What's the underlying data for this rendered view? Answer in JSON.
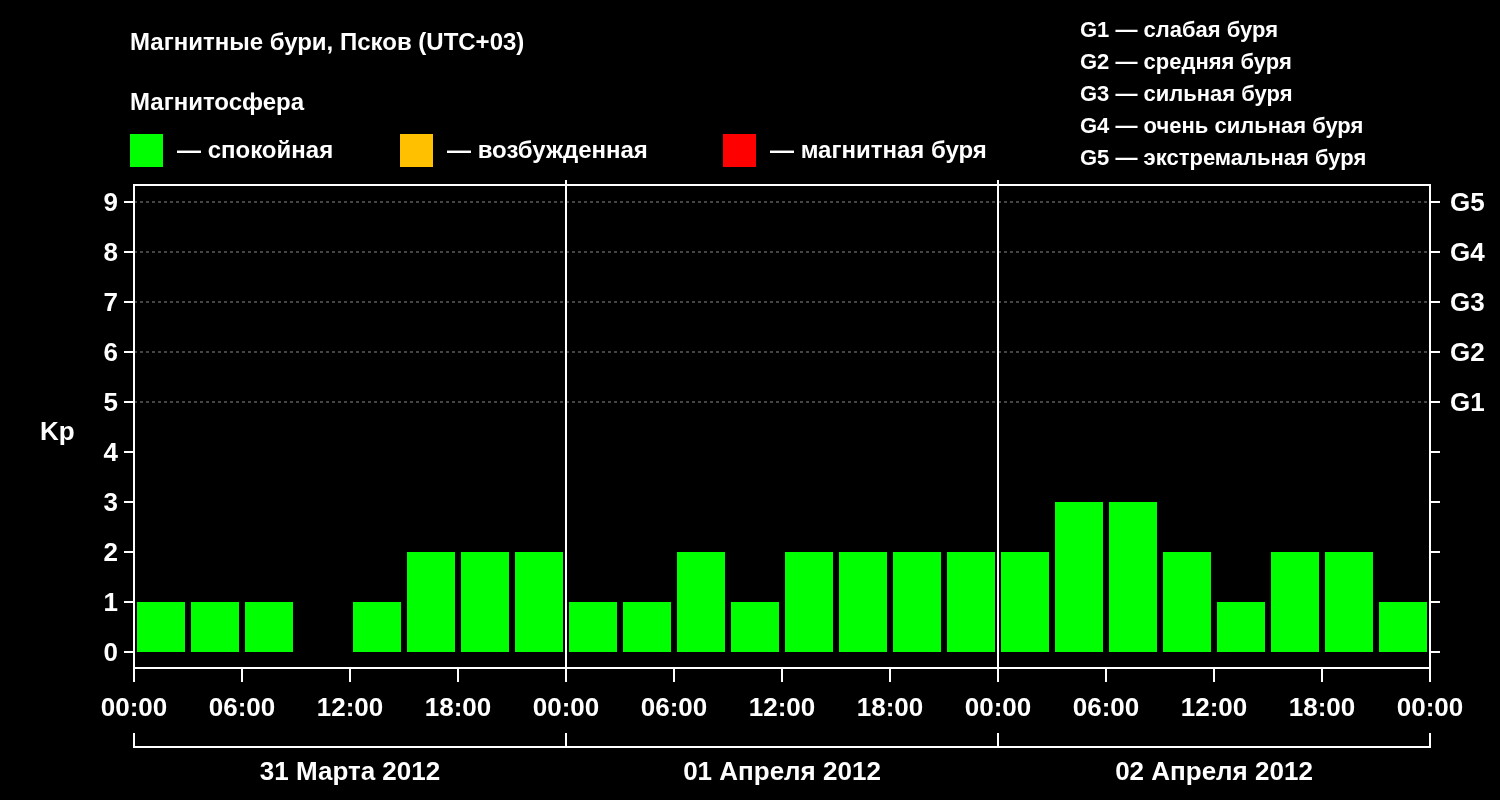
{
  "title": "Магнитные бури, Псков (UTC+03)",
  "legend": {
    "heading": "Магнитосфера",
    "items": [
      {
        "label": "— спокойная",
        "color": "#00ff00"
      },
      {
        "label": "— возбужденная",
        "color": "#ffc000"
      },
      {
        "label": "— магнитная буря",
        "color": "#ff0000"
      }
    ]
  },
  "storm_scale": [
    "G1 — слабая буря",
    "G2 — средняя буря",
    "G3 — сильная буря",
    "G4 — очень сильная буря",
    "G5 — экстремальная буря"
  ],
  "chart": {
    "chart_data": {
      "type": "bar",
      "ylabel": "Kp",
      "categories": [
        null,
        null,
        null,
        null,
        null,
        null,
        null,
        null,
        null,
        null,
        null,
        null,
        null,
        null,
        null,
        null,
        null,
        null,
        null,
        null,
        null,
        null,
        null,
        null
      ],
      "series": [
        {
          "values": [
            1,
            1,
            1,
            0,
            1,
            2,
            2,
            2,
            1,
            1,
            2,
            1,
            2,
            2,
            2,
            2,
            2,
            3,
            3,
            2,
            1,
            2,
            2,
            1
          ]
        }
      ],
      "ylim": [
        -0.32,
        9.34
      ],
      "yticks": [
        0,
        1,
        2,
        3,
        4,
        5,
        6,
        7,
        8,
        9
      ],
      "grid": true
    },
    "time_labels": [
      "00:00",
      "06:00",
      "12:00",
      "18:00",
      "00:00",
      "06:00",
      "12:00",
      "18:00",
      "00:00",
      "06:00",
      "12:00",
      "18:00",
      "00:00"
    ],
    "right_axis_labels": [
      "G5",
      "G4",
      "G3",
      "G2",
      "G1"
    ],
    "days": [
      "31 Марта 2012",
      "01 Апреля 2012",
      "02 Апреля 2012"
    ]
  }
}
